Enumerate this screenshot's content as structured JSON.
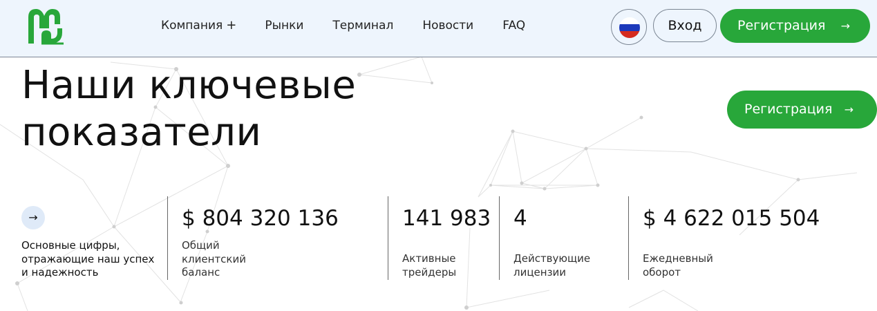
{
  "header": {
    "nav": [
      {
        "label": "Компания",
        "has_plus": true
      },
      {
        "label": "Рынки"
      },
      {
        "label": "Терминал"
      },
      {
        "label": "Новости"
      },
      {
        "label": "FAQ"
      }
    ],
    "plus_symbol": "+",
    "language_flag": "ru-flag-icon",
    "login_label": "Вход",
    "register_label": "Регистрация",
    "arrow": "→"
  },
  "hero": {
    "title_line1": "Наши ключевые",
    "title_line2": "показатели",
    "register_label": "Регистрация",
    "arrow": "→"
  },
  "stats": {
    "intro_arrow": "→",
    "intro_text": "Основные цифры, отражающие наш успех и надежность",
    "items": [
      {
        "value": "$ 804 320 136",
        "label": "Общий клиентский баланс"
      },
      {
        "value": "141 983",
        "label": "Активные трейдеры"
      },
      {
        "value": "4",
        "label": "Действующие лицензии"
      },
      {
        "value": "$ 4 622 015 504",
        "label": "Ежедневный оборот"
      }
    ]
  },
  "colors": {
    "accent_green": "#28a73a",
    "header_bg": "#eef5fd",
    "flag_white": "#ffffff",
    "flag_blue": "#1c39bb",
    "flag_red": "#d52b1e"
  }
}
